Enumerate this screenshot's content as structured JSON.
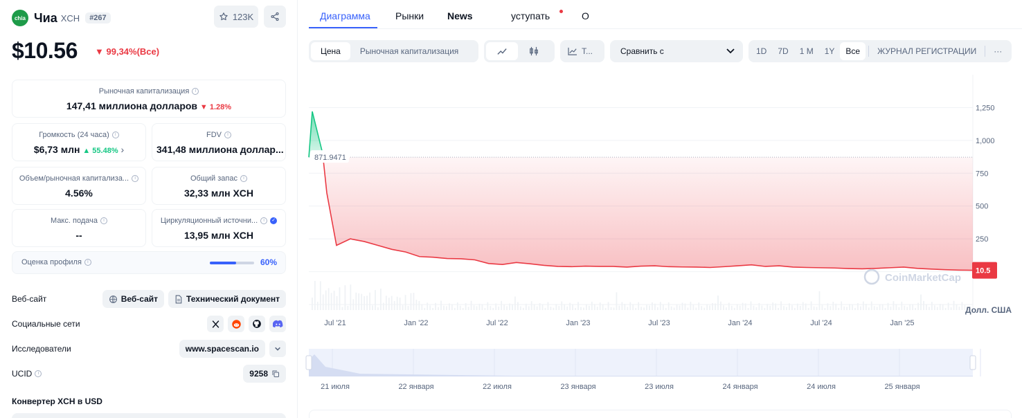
{
  "coin": {
    "logo_text": "chia",
    "name": "Чиа",
    "symbol": "XCH",
    "rank": "#267",
    "watchlist_count": "123K",
    "price": "$10.56",
    "price_change": "99,34%(Все)"
  },
  "stats": {
    "market_cap_label": "Рыночная капитализация",
    "market_cap_value": "147,41 миллиона долларов",
    "market_cap_change": "1.28%",
    "volume_label": "Громкость (24 часа)",
    "volume_value": "$6,73 млн",
    "volume_change": "55.48%",
    "fdv_label": "FDV",
    "fdv_value": "341,48 миллиона доллар...",
    "vol_mcap_label": "Объем/рыночная капитализа...",
    "vol_mcap_value": "4.56%",
    "total_supply_label": "Общий запас",
    "total_supply_value": "32,33 млн XCH",
    "max_supply_label": "Макс. подача",
    "max_supply_value": "--",
    "circ_supply_label": "Циркуляционный источни...",
    "circ_supply_value": "13,95 млн XCH"
  },
  "profile": {
    "label": "Оценка профиля",
    "value": "60%",
    "fraction": 0.6
  },
  "links": {
    "website_label": "Веб-сайт",
    "website_btn": "Веб-сайт",
    "whitepaper_btn": "Технический документ",
    "social_label": "Социальные сети",
    "explorers_label": "Исследователи",
    "explorer_btn": "www.spacescan.io",
    "ucid_label": "UCID",
    "ucid_value": "9258"
  },
  "converter_title": "Конвертер XCH в USD",
  "tabs": [
    "Диаграмма",
    "Рынки",
    "News",
    "уступать",
    "О"
  ],
  "chart_controls": {
    "price_btn": "Цена",
    "mcap_btn": "Рыночная капитализация",
    "tradingview_btn": "T...",
    "compare_label": "Сравнить с",
    "ranges": [
      "1D",
      "7D",
      "1 M",
      "1Y",
      "Все"
    ],
    "log_btn": "ЖУРНАЛ РЕГИСТРАЦИИ",
    "more": "···"
  },
  "colors": {
    "accent": "#3861fb",
    "down": "#ea3943",
    "up": "#16c784"
  },
  "chart_data": {
    "type": "line",
    "ylabel": "Долл. США",
    "yticks": [
      1250,
      1000,
      750,
      500,
      250
    ],
    "ylim": [
      -250,
      1500
    ],
    "start_marker": "871.9471",
    "current_label": "10.5",
    "watermark": "CoinMarketCap",
    "xticks": [
      "Jul '21",
      "Jan '22",
      "Jul '22",
      "Jan '23",
      "Jul '23",
      "Jan '24",
      "Jul '24",
      "Jan '25"
    ],
    "navigator_ticks": [
      "21 июля",
      "22 января",
      "22 июля",
      "23 января",
      "23 июля",
      "24 января",
      "24 июля",
      "25 января"
    ],
    "x": [
      "2021-05",
      "2021-05",
      "2021-06",
      "2021-06",
      "2021-07",
      "2021-08",
      "2021-09",
      "2021-10",
      "2021-11",
      "2021-12",
      "2022-01",
      "2022-02",
      "2022-03",
      "2022-04",
      "2022-05",
      "2022-06",
      "2022-07",
      "2022-08",
      "2022-09",
      "2022-10",
      "2022-11",
      "2022-12",
      "2023-01",
      "2023-02",
      "2023-03",
      "2023-04",
      "2023-05",
      "2023-06",
      "2023-07",
      "2023-08",
      "2023-09",
      "2023-10",
      "2023-11",
      "2023-12",
      "2024-01",
      "2024-02",
      "2024-03",
      "2024-04",
      "2024-05",
      "2024-06",
      "2024-07",
      "2024-08",
      "2024-09",
      "2024-10",
      "2024-11",
      "2024-12",
      "2025-01",
      "2025-02",
      "2025-03",
      "2025-04",
      "2025-05"
    ],
    "values": [
      871.9,
      1220,
      900,
      600,
      200,
      250,
      230,
      200,
      170,
      150,
      115,
      110,
      100,
      98,
      90,
      62,
      55,
      70,
      60,
      48,
      40,
      38,
      42,
      40,
      40,
      35,
      42,
      45,
      38,
      36,
      35,
      32,
      38,
      45,
      52,
      40,
      45,
      35,
      32,
      30,
      28,
      24,
      22,
      25,
      30,
      35,
      25,
      20,
      15,
      12,
      10.5
    ]
  }
}
